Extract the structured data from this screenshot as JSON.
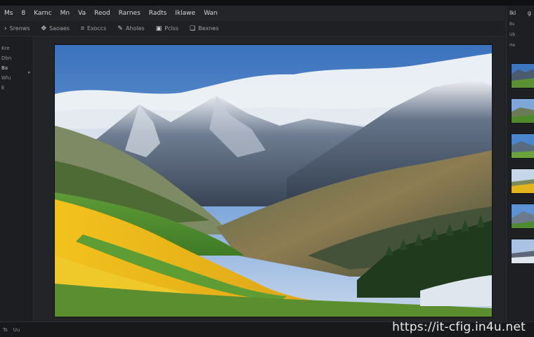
{
  "menubar": {
    "items": [
      "Ms",
      "8",
      "Karnc",
      "Mn",
      "Va",
      "Reod",
      "Rarnes",
      "Radts",
      "Iklawe",
      "Wan"
    ]
  },
  "toolbar": {
    "items": [
      {
        "label": "Srenws",
        "icon": "chevron-icon"
      },
      {
        "label": "Saoaes",
        "icon": "move-icon"
      },
      {
        "label": "Exoccs",
        "icon": "crop-icon"
      },
      {
        "label": "Aholes",
        "icon": "brush-icon"
      },
      {
        "label": "Pclss",
        "icon": "image-icon"
      },
      {
        "label": "Bexnes",
        "icon": "layer-icon"
      }
    ]
  },
  "left_panel": {
    "items": [
      "Kre",
      "Dbn",
      "Ba",
      "Wlu",
      "E"
    ]
  },
  "right_panel": {
    "title": "Ikl",
    "title_right": "g",
    "row_labels": [
      "Bs",
      "Ub",
      "He"
    ]
  },
  "status": {
    "items": [
      "Ts",
      "Uu"
    ]
  },
  "watermark": "https://it-cfig.in4u.net",
  "colors": {
    "sky_top": "#3f78c0",
    "sky_bottom": "#9cbde6",
    "field_yellow": "#e9b81a",
    "field_green": "#4f8a2e"
  }
}
